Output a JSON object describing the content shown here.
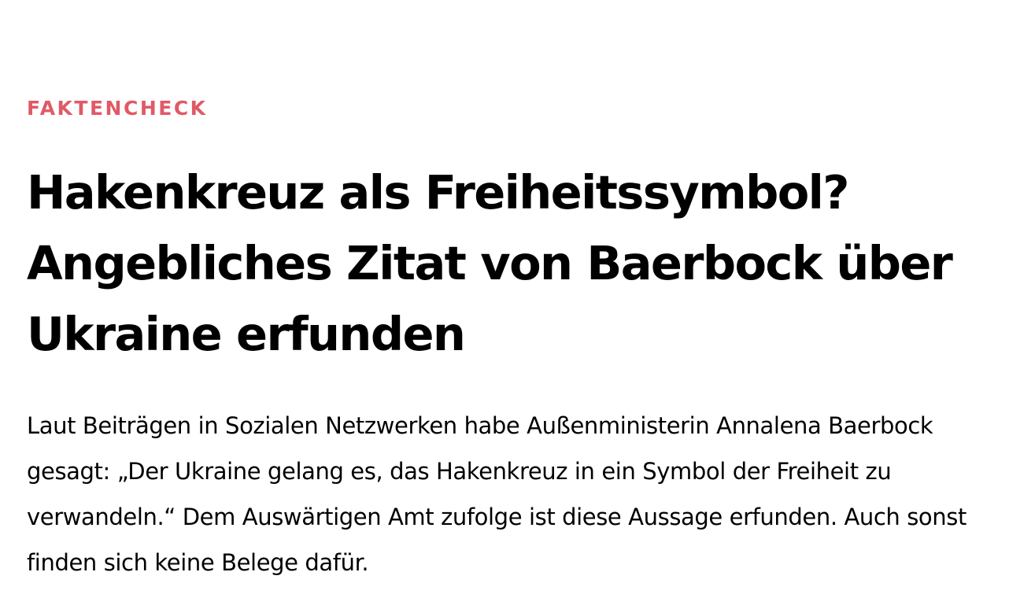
{
  "article": {
    "kicker": "FAKTENCHECK",
    "headline": "Hakenkreuz als Freiheitssymbol? Angebliches Zitat von Baerbock über Ukraine erfunden",
    "teaser": "Laut Beiträgen in Sozialen Netzwerken habe Außenministerin Annalena Baerbock gesagt: „Der Ukraine gelang es, das Hakenkreuz in ein Symbol der Freiheit zu verwandeln.“ Dem Auswärtigen Amt zufolge ist diese Aussage erfunden. Auch sonst finden sich keine Belege dafür."
  },
  "colors": {
    "kicker": "#e05a66",
    "text": "#000000",
    "background": "#ffffff"
  }
}
